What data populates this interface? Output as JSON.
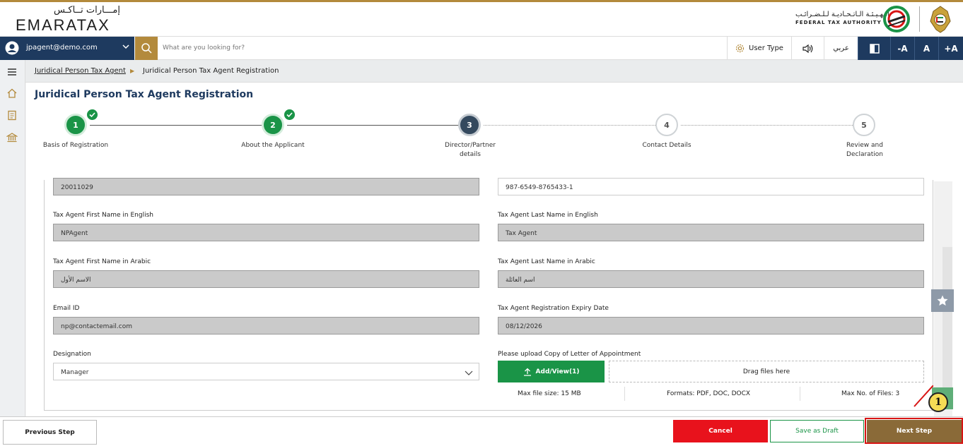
{
  "header": {
    "logo_ar": "إمـــارات تــاكـس",
    "logo_en": "EMARATAX",
    "fta_ar": "الـهـيـئـة الـاتـحـاديـة لـلـضـرائـب",
    "fta_en": "FEDERAL TAX AUTHORITY"
  },
  "navbar": {
    "user_email": "jpagent@demo.com",
    "search_placeholder": "What are you looking for?",
    "user_type": "User Type",
    "language": "عربي",
    "font_decrease": "-A",
    "font_normal": "A",
    "font_increase": "+A"
  },
  "breadcrumb": {
    "link": "Juridical Person Tax Agent",
    "current": "Juridical Person Tax Agent Registration"
  },
  "page": {
    "title": "Juridical Person Tax Agent Registration"
  },
  "steps": [
    {
      "number": "1",
      "label": "Basis of Registration",
      "status": "done"
    },
    {
      "number": "2",
      "label": "About the Applicant",
      "status": "done"
    },
    {
      "number": "3",
      "label": "Director/Partner details",
      "status": "active"
    },
    {
      "number": "4",
      "label": "Contact Details",
      "status": "todo"
    },
    {
      "number": "5",
      "label": "Review and Declaration",
      "status": "todo"
    }
  ],
  "form": {
    "top_left_value": "20011029",
    "top_right_value": "987-6549-8765433-1",
    "first_name_en_label": "Tax Agent First Name in English",
    "first_name_en_value": "NPAgent",
    "last_name_en_label": "Tax Agent Last Name in English",
    "last_name_en_value": "Tax Agent",
    "first_name_ar_label": "Tax Agent First Name in Arabic",
    "first_name_ar_value": "الاسم الأول",
    "last_name_ar_label": "Tax Agent Last Name in Arabic",
    "last_name_ar_value": "اسم العائلة",
    "email_label": "Email ID",
    "email_value": "np@contactemail.com",
    "expiry_label": "Tax Agent Registration Expiry Date",
    "expiry_value": "08/12/2026",
    "designation_label": "Designation",
    "designation_value": "Manager",
    "upload_label": "Please upload Copy of Letter of Appointment",
    "upload_button": "Add/View(1)",
    "drop_text": "Drag files here",
    "max_size": "Max file size: 15 MB",
    "formats": "Formats: PDF, DOC, DOCX",
    "max_files": "Max No. of Files: 3"
  },
  "footer": {
    "previous": "Previous Step",
    "cancel": "Cancel",
    "save_draft": "Save as Draft",
    "next": "Next Step"
  },
  "annotation": {
    "callout_number": "1"
  },
  "colors": {
    "primary_navy": "#1e3a5f",
    "gold": "#b38a3c",
    "green": "#1a9447",
    "cancel_red": "#e8121c",
    "next_brown": "#8a6a38",
    "highlight_red": "#d81414"
  }
}
